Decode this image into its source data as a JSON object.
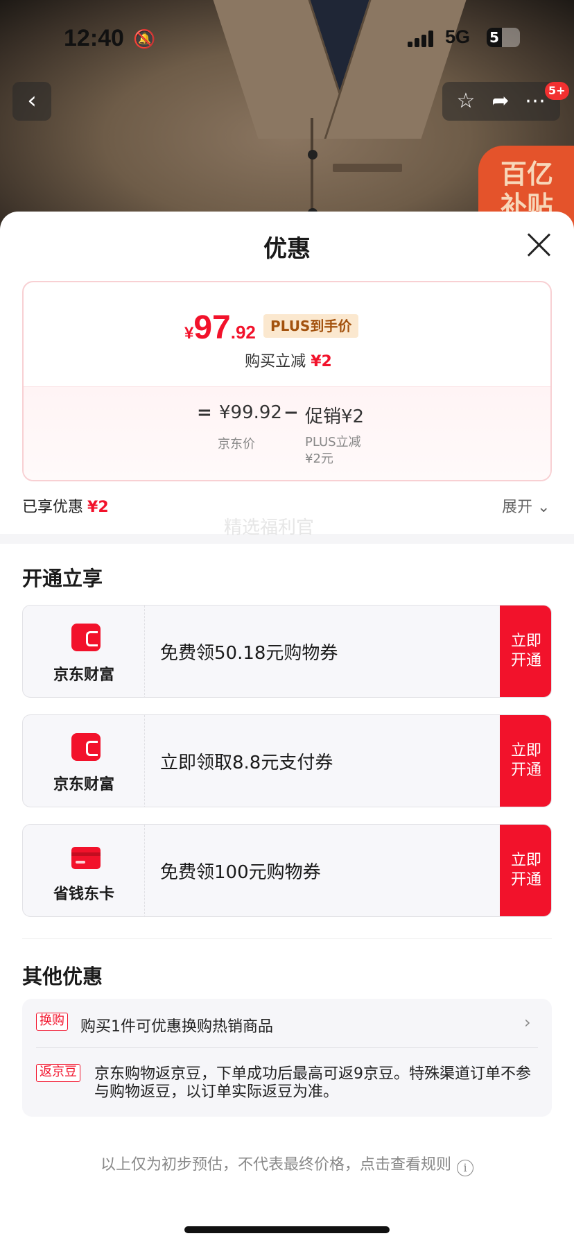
{
  "status_bar": {
    "time": "12:40",
    "network": "5G",
    "battery": "5"
  },
  "top_nav": {
    "badge": "5+",
    "subsidy": [
      "百亿",
      "补贴"
    ]
  },
  "sheet": {
    "title": "优惠",
    "price": {
      "yen": "¥",
      "integer": "97",
      "decimal": ".92",
      "tag": "PLUS到手价"
    },
    "buy_reduce": {
      "label": "购买立减",
      "amount": "¥2"
    },
    "calc": {
      "equals": "=",
      "jd_price": "¥99.92",
      "minus": "−",
      "promo": "促销¥2",
      "jd_label": "京东价",
      "promo_label_1": "PLUS立减",
      "promo_label_2": "¥2元"
    },
    "enjoyed": {
      "label": "已享优惠",
      "amount": "¥2"
    },
    "expand": "展开"
  },
  "open_section": {
    "title": "开通立享",
    "watermark": "精选福利官",
    "offers": [
      {
        "brand": "京东财富",
        "desc": "免费领50.18元购物券",
        "cta_1": "立即",
        "cta_2": "开通"
      },
      {
        "brand": "京东财富",
        "desc": "立即领取8.8元支付券",
        "cta_1": "立即",
        "cta_2": "开通"
      },
      {
        "brand": "省钱东卡",
        "desc": "免费领100元购物券",
        "cta_1": "立即",
        "cta_2": "开通"
      }
    ]
  },
  "other_section": {
    "title": "其他优惠",
    "items": [
      {
        "tag": "换购",
        "text": "购买1件可优惠换购热销商品"
      },
      {
        "tag": "返京豆",
        "text": "京东购物返京豆，下单成功后最高可返9京豆。特殊渠道订单不参与购物返豆，以订单实际返豆为准。"
      }
    ]
  },
  "footnote": "以上仅为初步预估，不代表最终价格，点击查看规则",
  "colors": {
    "accent": "#f2122b",
    "plus_tag_bg": "#fbe8cf",
    "plus_tag_text": "#a3520e"
  }
}
